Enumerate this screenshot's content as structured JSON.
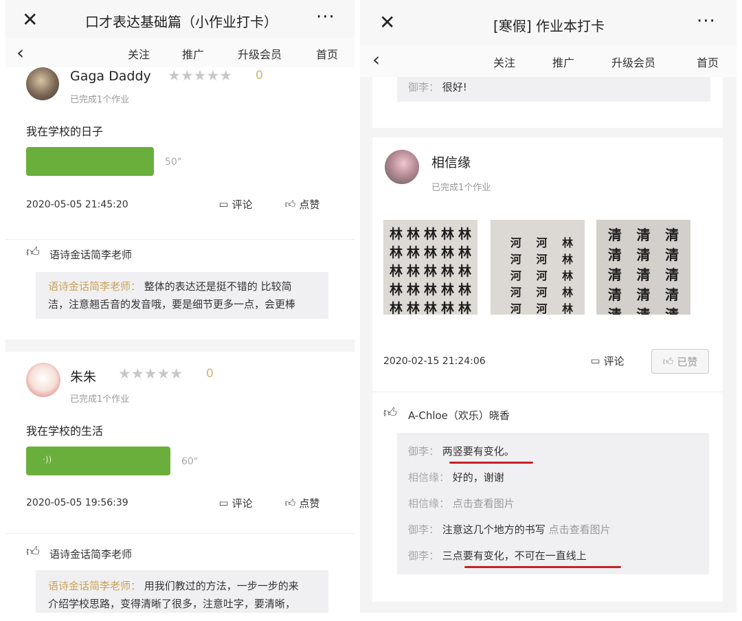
{
  "left": {
    "title": "口才表达基础篇（小作业打卡）",
    "close_label": "✕",
    "more_label": "···",
    "back_label": "‹",
    "nav": [
      "关注",
      "推广",
      "升级会员",
      "首页"
    ],
    "posts": [
      {
        "user": "Gaga Daddy",
        "stars": "★★★★★",
        "score": "0",
        "done": "已完成1个作业",
        "topic": "我在学校的日子",
        "voice_icon": "",
        "duration": "50\"",
        "time": "2020-05-05 21:45:20",
        "comment_label": "评论",
        "like_label": "点赞",
        "liker": "语诗金话简李老师",
        "comment_author": "语诗金话简李老师：",
        "comment_text_1": "整体的表达还是挺不错的 比较简",
        "comment_text_2": "洁，注意翘舌音的发音哦，要是细节更多一点，会更棒"
      },
      {
        "user": "朱朱",
        "stars": "★★★★★",
        "score": "0",
        "done": "已完成1个作业",
        "topic": "我在学校的生活",
        "voice_icon": "·))",
        "duration": "60\"",
        "time": "2020-05-05 19:56:39",
        "comment_label": "评论",
        "like_label": "点赞",
        "liker": "语诗金话简李老师",
        "comment_author": "语诗金话简李老师：",
        "comment_text_1": "用我们教过的方法，一步一步的来",
        "comment_text_2": "介绍学校思路，变得清晰了很多，注意吐字，要清晰，"
      }
    ]
  },
  "right": {
    "title": "[寒假] 作业本打卡",
    "close_label": "✕",
    "more_label": "···",
    "back_label": "‹",
    "nav": [
      "关注",
      "推广",
      "升级会员",
      "首页"
    ],
    "prev_comment_author": "御李：",
    "prev_comment_text": "很好!",
    "post": {
      "user": "相信缘",
      "done": "已完成1个作业",
      "photo_chars": [
        "林",
        "河林",
        "清"
      ],
      "time": "2020-02-15 21:24:06",
      "comment_label": "评论",
      "liked_label": "已赞",
      "liker": "A-Chloe（欢乐）晓香",
      "comments": [
        {
          "author": "御李：",
          "text": "两竖要有变化。",
          "link": ""
        },
        {
          "author": "相信缘：",
          "text": "好的，谢谢",
          "link": ""
        },
        {
          "author": "相信缘：",
          "text": "",
          "link": "点击查看图片"
        },
        {
          "author": "御李：",
          "text": "注意这几个地方的书写",
          "link": "点击查看图片"
        },
        {
          "author": "御李：",
          "text": "三点要有变化，不可在一直线上",
          "link": ""
        }
      ]
    }
  },
  "colors": {
    "voice_green": "#6aae3c",
    "author_gold": "#c9a35a",
    "annotation_red": "#c8202a"
  },
  "icons": {
    "close": "close-icon",
    "more": "more-icon",
    "back": "back-arrow-icon",
    "comment": "comment-icon",
    "like": "thumbs-up-icon",
    "voice": "voice-wave-icon"
  }
}
